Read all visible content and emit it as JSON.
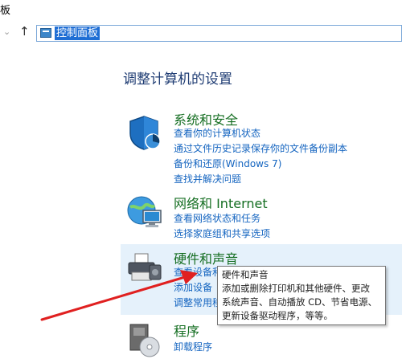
{
  "window": {
    "title": "板"
  },
  "address": {
    "path": "控制面板"
  },
  "main": {
    "heading": "调整计算机的设置",
    "categories": [
      {
        "title": "系统和安全",
        "links": [
          "查看你的计算机状态",
          "通过文件历史记录保存你的文件备份副本",
          "备份和还原(Windows 7)",
          "查找并解决问题"
        ],
        "icon": "shield-icon"
      },
      {
        "title": "网络和 Internet",
        "links": [
          "查看网络状态和任务",
          "选择家庭组和共享选项"
        ],
        "icon": "network-globe-icon"
      },
      {
        "title": "硬件和声音",
        "links": [
          "查看设备和打印机",
          "添加设备",
          "调整常用移动设置"
        ],
        "icon": "printer-icon"
      },
      {
        "title": "程序",
        "links": [
          "卸载程序"
        ],
        "icon": "programs-disc-icon"
      }
    ]
  },
  "tooltip": {
    "lines": [
      "硬件和声音",
      "添加或删除打印机和其他硬件、更改",
      "系统声音、自动播放 CD、节省电源、",
      "更新设备驱动程序，等等。"
    ]
  },
  "colors": {
    "link": "#1565c0",
    "category_title": "#156e22",
    "heading": "#1f3c73",
    "highlight": "#e5f1fb",
    "annotation_arrow": "#e02020"
  }
}
